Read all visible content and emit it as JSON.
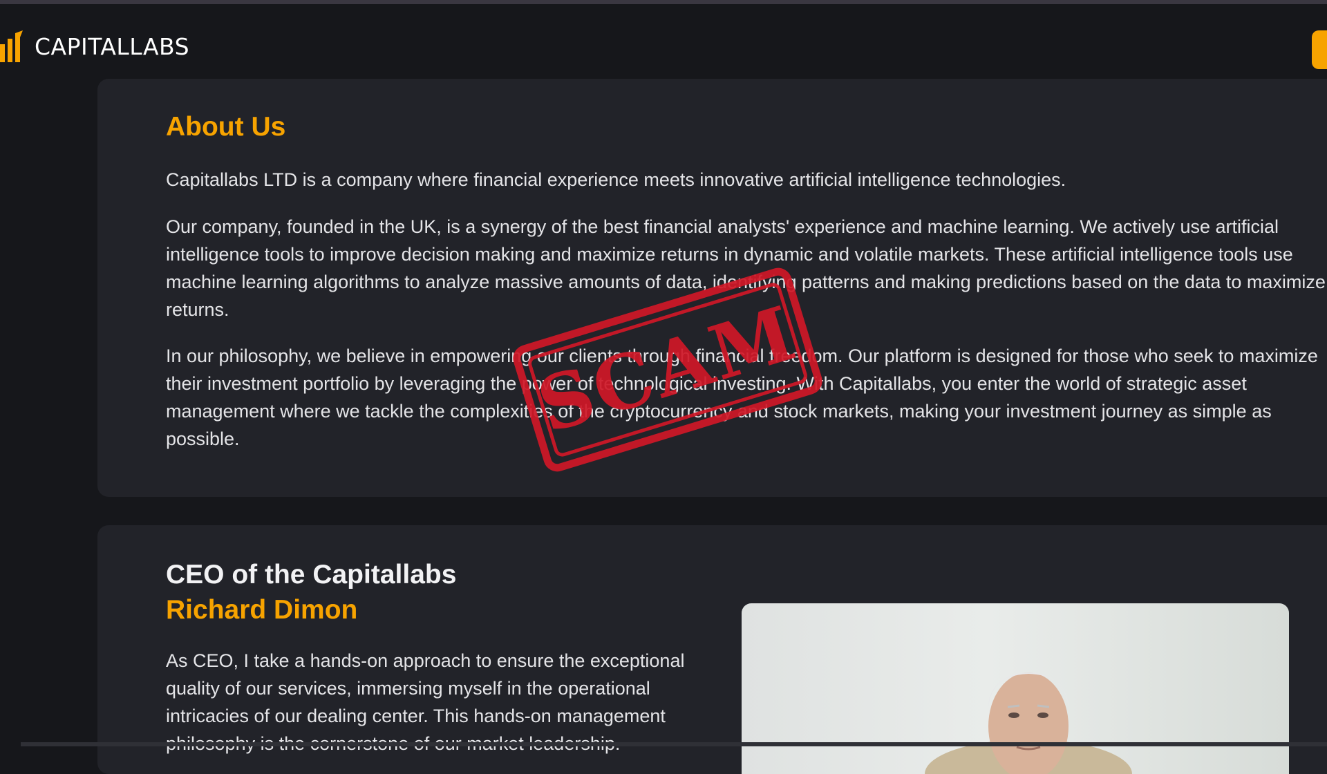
{
  "brand": {
    "name": "CAPITALLABS",
    "accent_color": "#f7a300",
    "logo_icon": "bar-chart-logo-icon"
  },
  "about": {
    "title": "About Us",
    "paragraphs": [
      "Capitallabs LTD is a company where financial experience meets innovative artificial intelligence technologies.",
      "Our company, founded in the UK, is a synergy of the best financial analysts' experience and machine learning. We actively use artificial intelligence tools to improve decision making and maximize returns in dynamic and volatile markets. These artificial intelligence tools use machine learning algorithms to analyze massive amounts of data, identifying patterns and making predictions based on the data to maximize returns.",
      "In our philosophy, we believe in empowering our clients through financial freedom. Our platform is designed for those who seek to maximize their investment portfolio by leveraging the power of technological investing. With Capitallabs, you enter the world of strategic asset management where we tackle the complexities of the cryptocurrency and stock markets, making your investment journey as simple as possible."
    ]
  },
  "stamp": {
    "text": "SCAM",
    "color": "#d01827"
  },
  "ceo": {
    "title": "CEO of the Capitallabs",
    "name": "Richard Dimon",
    "text": "As CEO, I take a hands-on approach to ensure the exceptional quality of our services, immersing myself in the operational intricacies of our dealing center. This hands-on management philosophy is the cornerstone of our market leadership."
  }
}
